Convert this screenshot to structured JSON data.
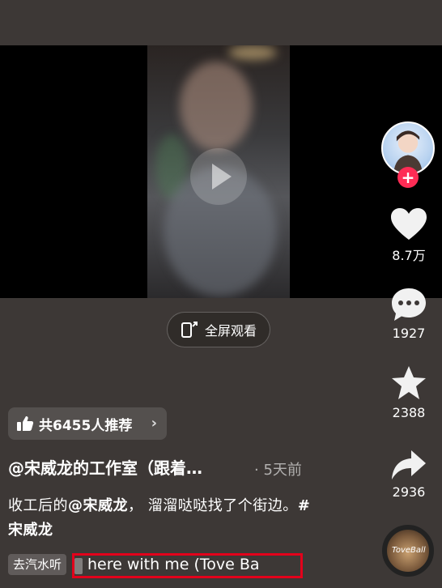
{
  "video": {
    "fullscreen_label": "全屏观看"
  },
  "rail": {
    "likes": "8.7万",
    "comments": "1927",
    "favorites": "2388",
    "shares": "2936",
    "plus": "+"
  },
  "recommend": {
    "label": "共6455人推荐",
    "chevron": "›"
  },
  "post": {
    "author": "@宋威龙的工作室（跟着…",
    "time": "· 5天前",
    "caption_prefix": "收工后的",
    "caption_mention": "@宋威龙",
    "caption_rest": "， 溜溜哒哒找了个街边。",
    "caption_tag": "#宋威龙"
  },
  "music": {
    "listen_tag": "去汽水听",
    "title": "here with me (Tove Ba",
    "disc_label": "ToveBall"
  },
  "colors": {
    "accent": "#fe2c55",
    "background": "#3d3836",
    "highlight": "#e3001b"
  }
}
